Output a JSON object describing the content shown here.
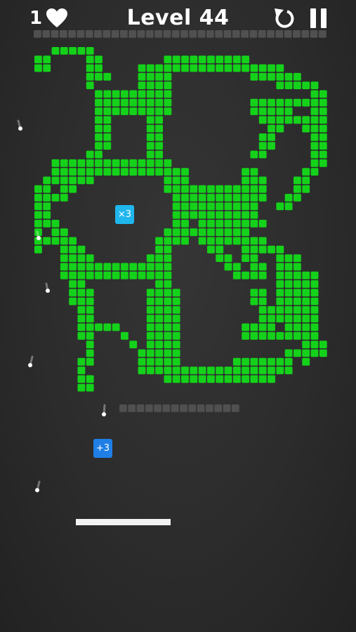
{
  "hud": {
    "lives": "1",
    "level_label": "Level 44",
    "heart_icon": "heart-icon",
    "restart_icon": "restart-icon",
    "pause_icon": "pause-icon"
  },
  "powerups": {
    "multiply": "×3",
    "add": "+3"
  },
  "colors": {
    "brick": "#14d21a",
    "barrier": "#505050",
    "multiply_bg": "#1fb6ee",
    "add_bg": "#1f7fe6",
    "paddle": "#f2f2f2"
  }
}
